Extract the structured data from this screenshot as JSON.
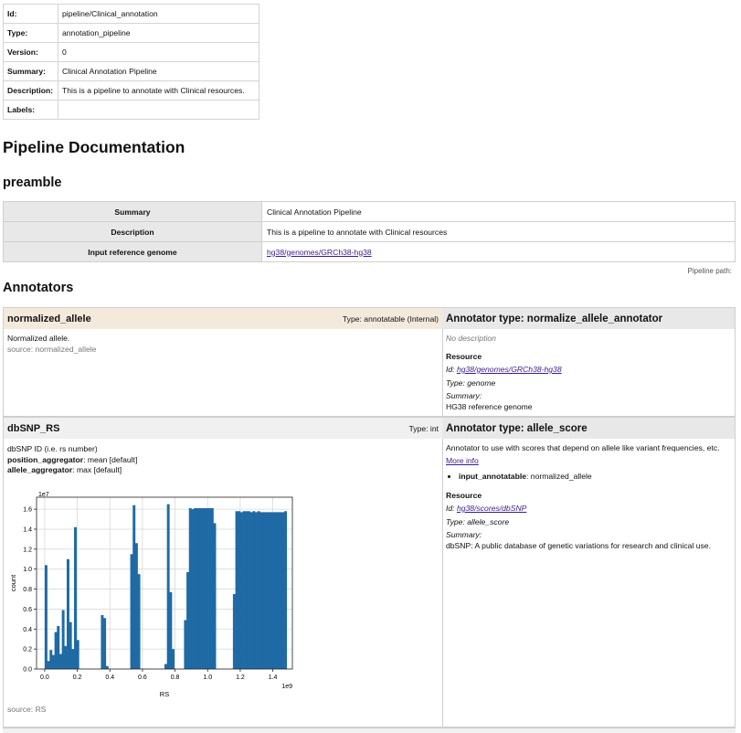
{
  "info": [
    {
      "key": "Id:",
      "value": "pipeline/Clinical_annotation"
    },
    {
      "key": "Type:",
      "value": "annotation_pipeline"
    },
    {
      "key": "Version:",
      "value": "0"
    },
    {
      "key": "Summary:",
      "value": "Clinical Annotation Pipeline"
    },
    {
      "key": "Description:",
      "value": "This is a pipeline to annotate with Clinical resources."
    },
    {
      "key": "Labels:",
      "value": ""
    }
  ],
  "doc_title": "Pipeline Documentation",
  "preamble": {
    "title": "preamble",
    "rows": [
      {
        "key": "Summary",
        "value": "Clinical Annotation Pipeline"
      },
      {
        "key": "Description",
        "value": "This is a pipeline to annotate with Clinical resources"
      },
      {
        "key": "Input reference genome",
        "value": "hg38/genomes/GRCh38-hg38"
      }
    ]
  },
  "pipeline_path_label": "Pipeline path:",
  "annotators_title": "Annotators",
  "annotators": [
    {
      "name": "normalized_allele",
      "type": "Type: annotatable (Internal)",
      "description": "Normalized allele.",
      "source": "source: normalized_allele",
      "right_title": "Annotator type: normalize_allele_annotator",
      "right_desc": "No description",
      "resource_label": "Resource",
      "resource_id_label": "Id:",
      "resource_id": "hg38/genomes/GRCh38-hg38",
      "resource_type": "Type: genome",
      "resource_summary_label": "Summary:",
      "resource_summary": "HG38 reference genome"
    },
    {
      "name": "dbSNP_RS",
      "type": "Type: int",
      "description": "dbSNP ID (i.e. rs number)",
      "position_aggregator_label": "position_aggregator",
      "position_aggregator_value": ": mean [default]",
      "allele_aggregator_label": "allele_aggregator",
      "allele_aggregator_value": ": max [default]",
      "source": "source: RS",
      "right_title": "Annotator type: allele_score",
      "right_desc": "Annotator to use with scores that depend on allele like variant frequencies, etc.",
      "more_info": "More info",
      "input_label": "input_annotatable",
      "input_value": ": normalized_allele",
      "resource_label": "Resource",
      "resource_id_label": "Id:",
      "resource_id": "hg38/scores/dbSNP",
      "resource_type": "Type: allele_score",
      "resource_summary_label": "Summary:",
      "resource_summary": "dbSNP: A public database of genetic variations for research and clinical use."
    }
  ],
  "chart_data": {
    "type": "bar",
    "xlabel": "RS",
    "ylabel": "count",
    "x_offset_label": "1e9",
    "y_offset_label": "1e7",
    "xlim": [
      -0.05,
      1.52
    ],
    "ylim": [
      0,
      1.72
    ],
    "xticks": [
      0.0,
      0.2,
      0.4,
      0.6,
      0.8,
      1.0,
      1.2,
      1.4
    ],
    "xtick_labels": [
      "0.0",
      "0.2",
      "0.4",
      "0.6",
      "0.8",
      "1.0",
      "1.2",
      "1.4"
    ],
    "yticks": [
      0.0,
      0.2,
      0.4,
      0.6,
      0.8,
      1.0,
      1.2,
      1.4,
      1.6
    ],
    "ytick_labels": [
      "0.0",
      "0.2",
      "0.4",
      "0.6",
      "0.8",
      "1.0",
      "1.2",
      "1.4",
      "1.6"
    ],
    "grid": true,
    "bar_color": "#1f6aa5",
    "bin_width": 0.015,
    "x": [
      0.0,
      0.015,
      0.03,
      0.045,
      0.06,
      0.075,
      0.09,
      0.105,
      0.12,
      0.135,
      0.15,
      0.165,
      0.18,
      0.195,
      0.345,
      0.36,
      0.375,
      0.525,
      0.54,
      0.555,
      0.57,
      0.735,
      0.75,
      0.765,
      0.78,
      0.855,
      0.87,
      0.885,
      0.9,
      0.915,
      0.93,
      0.945,
      0.96,
      0.975,
      0.99,
      1.005,
      1.02,
      1.035,
      1.155,
      1.17,
      1.185,
      1.2,
      1.215,
      1.23,
      1.245,
      1.26,
      1.275,
      1.29,
      1.305,
      1.32,
      1.335,
      1.35,
      1.365,
      1.38,
      1.395,
      1.41,
      1.425,
      1.44,
      1.455,
      1.47
    ],
    "values": [
      1.04,
      0.08,
      0.19,
      0.14,
      0.37,
      0.43,
      0.15,
      0.59,
      0.23,
      1.1,
      0.47,
      0.2,
      1.42,
      0.29,
      0.54,
      0.51,
      0.03,
      1.15,
      1.64,
      1.26,
      0.95,
      0.05,
      1.65,
      0.77,
      0.2,
      0.49,
      0.97,
      1.61,
      1.6,
      1.61,
      1.61,
      1.61,
      1.61,
      1.61,
      1.61,
      1.61,
      1.61,
      1.46,
      0.75,
      1.58,
      1.58,
      1.57,
      1.58,
      1.58,
      1.58,
      1.57,
      1.58,
      1.57,
      1.58,
      1.57,
      1.57,
      1.57,
      1.57,
      1.57,
      1.57,
      1.57,
      1.57,
      1.57,
      1.57,
      1.58
    ]
  }
}
